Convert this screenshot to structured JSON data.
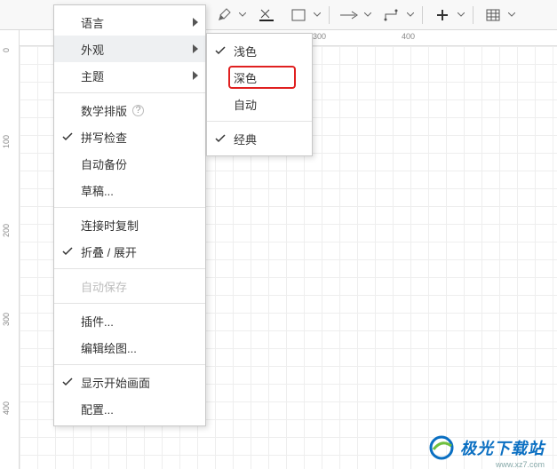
{
  "toolbar": {
    "tools": [
      "pencil",
      "line-color",
      "rect",
      "arrow",
      "connector",
      "plus",
      "table"
    ]
  },
  "rulers": {
    "left": [
      {
        "label": "0",
        "pos": 20
      },
      {
        "label": "100",
        "pos": 118
      },
      {
        "label": "200",
        "pos": 218
      },
      {
        "label": "300",
        "pos": 318
      },
      {
        "label": "400",
        "pos": 418
      }
    ],
    "top": [
      {
        "label": "300",
        "pos": 330
      },
      {
        "label": "400",
        "pos": 430
      }
    ]
  },
  "menu": {
    "main": [
      {
        "label": "语言",
        "submenu": true
      },
      {
        "label": "外观",
        "submenu": true,
        "hover": true
      },
      {
        "label": "主题",
        "submenu": true
      },
      {
        "divider": true
      },
      {
        "label": "数学排版",
        "help": true
      },
      {
        "label": "拼写检查",
        "checked": true
      },
      {
        "label": "自动备份"
      },
      {
        "label": "草稿..."
      },
      {
        "divider": true
      },
      {
        "label": "连接时复制"
      },
      {
        "label": "折叠 / 展开",
        "checked": true
      },
      {
        "divider": true
      },
      {
        "label": "自动保存",
        "disabled": true
      },
      {
        "divider": true
      },
      {
        "label": "插件..."
      },
      {
        "label": "编辑绘图..."
      },
      {
        "divider": true
      },
      {
        "label": "显示开始画面",
        "checked": true
      },
      {
        "label": "配置..."
      }
    ],
    "appearance": [
      {
        "label": "浅色",
        "checked": true
      },
      {
        "label": "深色",
        "highlight": true
      },
      {
        "label": "自动"
      },
      {
        "divider": true
      },
      {
        "label": "经典",
        "checked": true
      }
    ]
  },
  "watermark": {
    "text": "极光下载站",
    "url": "www.xz7.com"
  }
}
